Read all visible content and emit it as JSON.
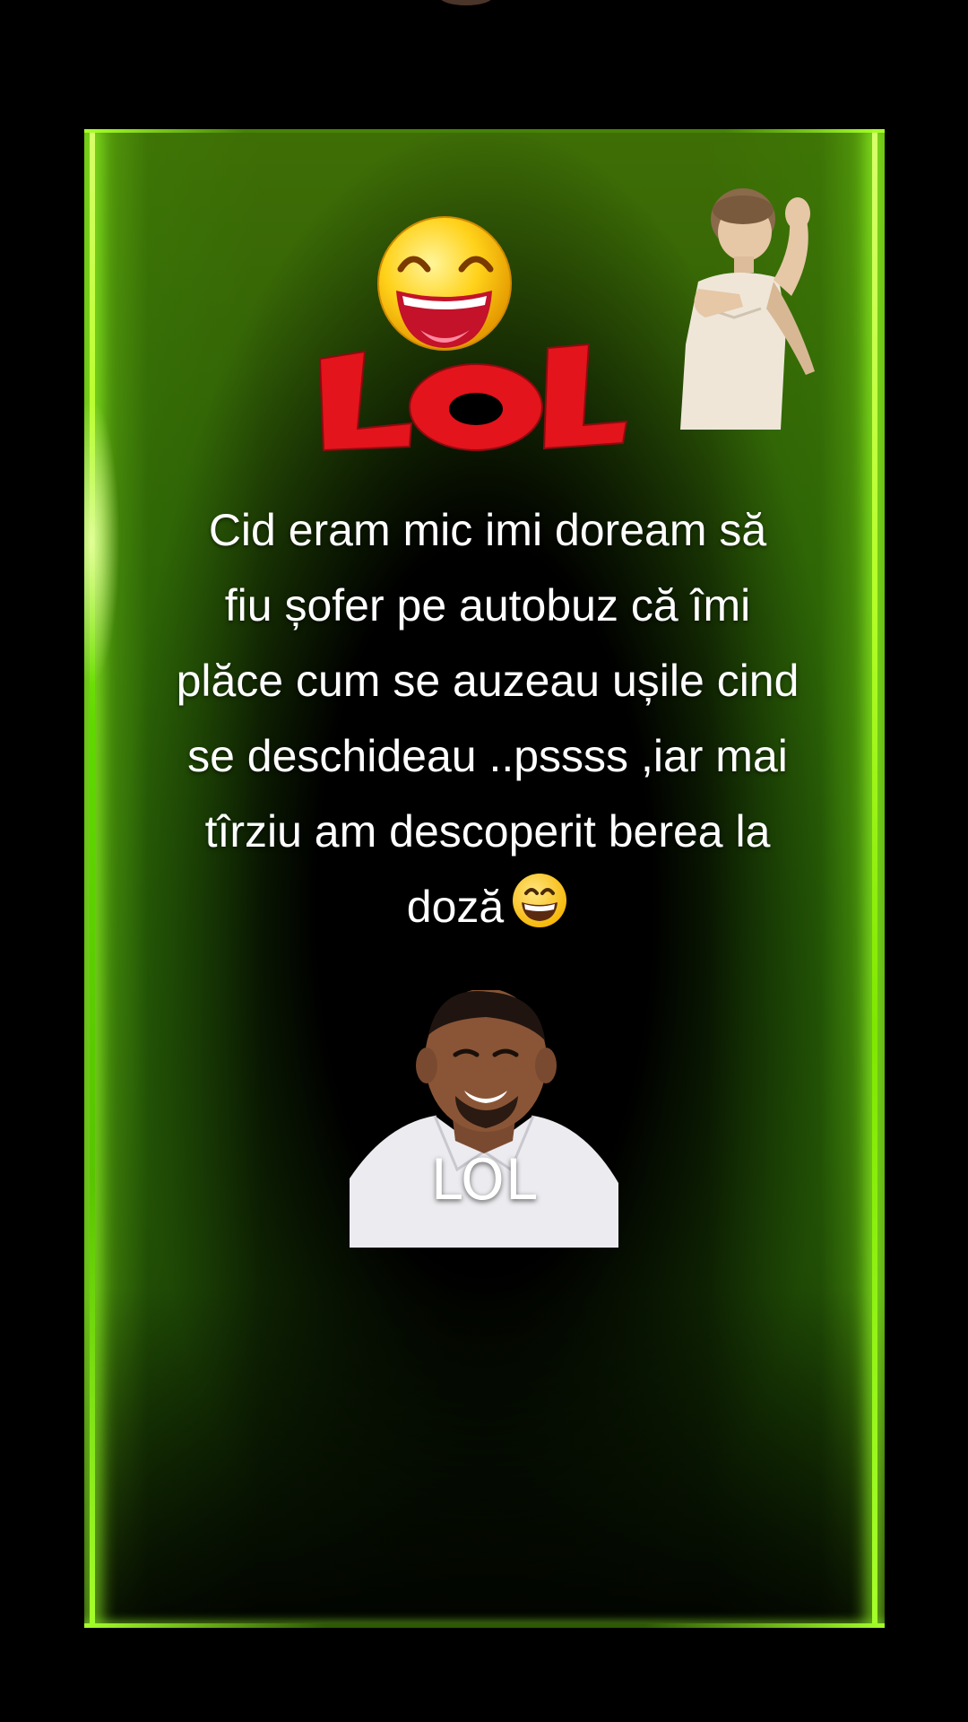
{
  "caption": {
    "lines": [
      "Cid eram mic imi doream să",
      "fiu șofer pe autobuz că îmi",
      "plăce cum se auzeau ușile cind",
      "se deschideau ..pssss ,iar mai",
      "tîrziu am descoperit berea la",
      "doză"
    ],
    "trailing_emoji": "grinning-face-emoji"
  },
  "stickers": {
    "lol_logo": {
      "text": "LOL",
      "icon": "laughing-smiley-icon"
    },
    "boy": {
      "icon": "dancing-boy-image"
    },
    "man": {
      "label": "LOL",
      "icon": "laughing-man-image"
    }
  },
  "colors": {
    "background": "#000000",
    "glow": "#a6ff2a",
    "lol_red": "#e3141b",
    "smiley_yellow": "#ffd21a",
    "text": "#ffffff"
  }
}
